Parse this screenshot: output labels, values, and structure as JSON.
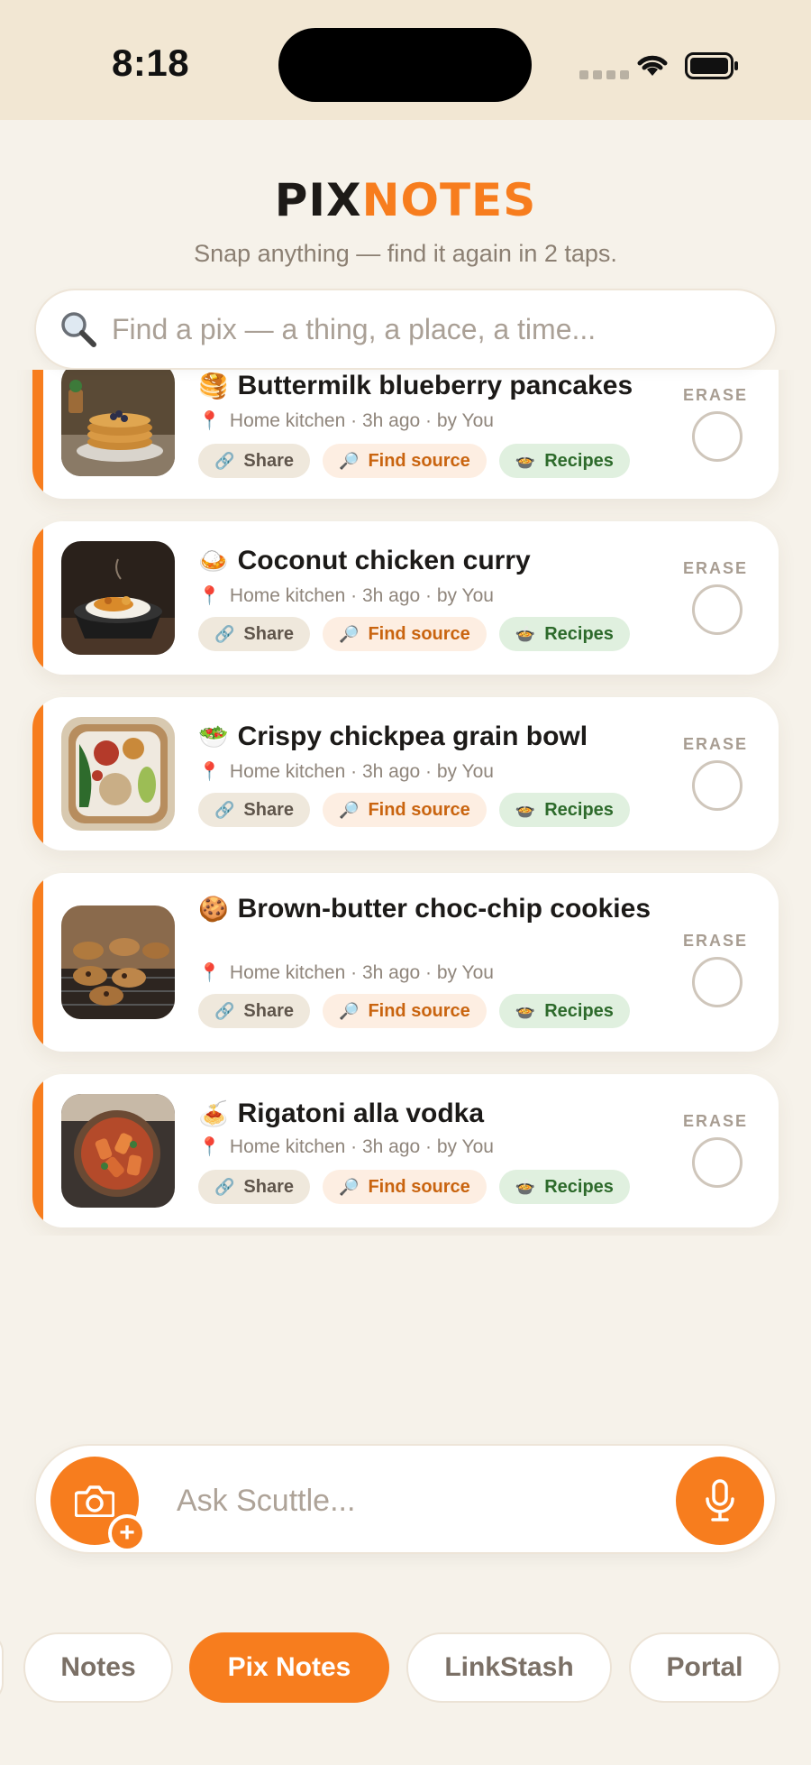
{
  "status": {
    "time": "8:18"
  },
  "brand": {
    "part1": "PIX",
    "part2": "NOTES"
  },
  "tagline": "Snap anything — find it again in 2 taps.",
  "search": {
    "placeholder": "Find a pix — a thing, a place, a time..."
  },
  "chip_labels": {
    "share": "Share",
    "source": "Find source",
    "recipes": "Recipes"
  },
  "erase_label": "ERASE",
  "items": [
    {
      "emoji": "🥞",
      "title": "Buttermilk blueberry pancakes",
      "meta": "Home kitchen · 3h ago · by You",
      "share": "Share",
      "source": "Find source",
      "recipes": "Recipes",
      "erase": "ERASE"
    },
    {
      "emoji": "🍛",
      "title": "Coconut chicken curry",
      "meta": "Home kitchen · 3h ago · by You",
      "share": "Share",
      "source": "Find source",
      "recipes": "Recipes",
      "erase": "ERASE"
    },
    {
      "emoji": "🥗",
      "title": "Crispy chickpea grain bowl",
      "meta": "Home kitchen · 3h ago · by You",
      "share": "Share",
      "source": "Find source",
      "recipes": "Recipes",
      "erase": "ERASE"
    },
    {
      "emoji": "🍪",
      "title": "Brown-butter choc-chip cookies",
      "meta": "Home kitchen · 3h ago · by You",
      "share": "Share",
      "source": "Find source",
      "recipes": "Recipes",
      "erase": "ERASE"
    },
    {
      "emoji": "🍝",
      "title": "Rigatoni alla vodka",
      "meta": "Home kitchen · 3h ago · by You",
      "share": "Share",
      "source": "Find source",
      "recipes": "Recipes",
      "erase": "ERASE"
    }
  ],
  "ask": {
    "placeholder": "Ask Scuttle..."
  },
  "tabs": [
    {
      "label": "Notes",
      "active": false
    },
    {
      "label": "Pix Notes",
      "active": true
    },
    {
      "label": "LinkStash",
      "active": false
    },
    {
      "label": "Portal",
      "active": false
    }
  ],
  "colors": {
    "accent": "#f77d1e",
    "background": "#f6f2ea",
    "status_bar": "#f2e7d3"
  }
}
